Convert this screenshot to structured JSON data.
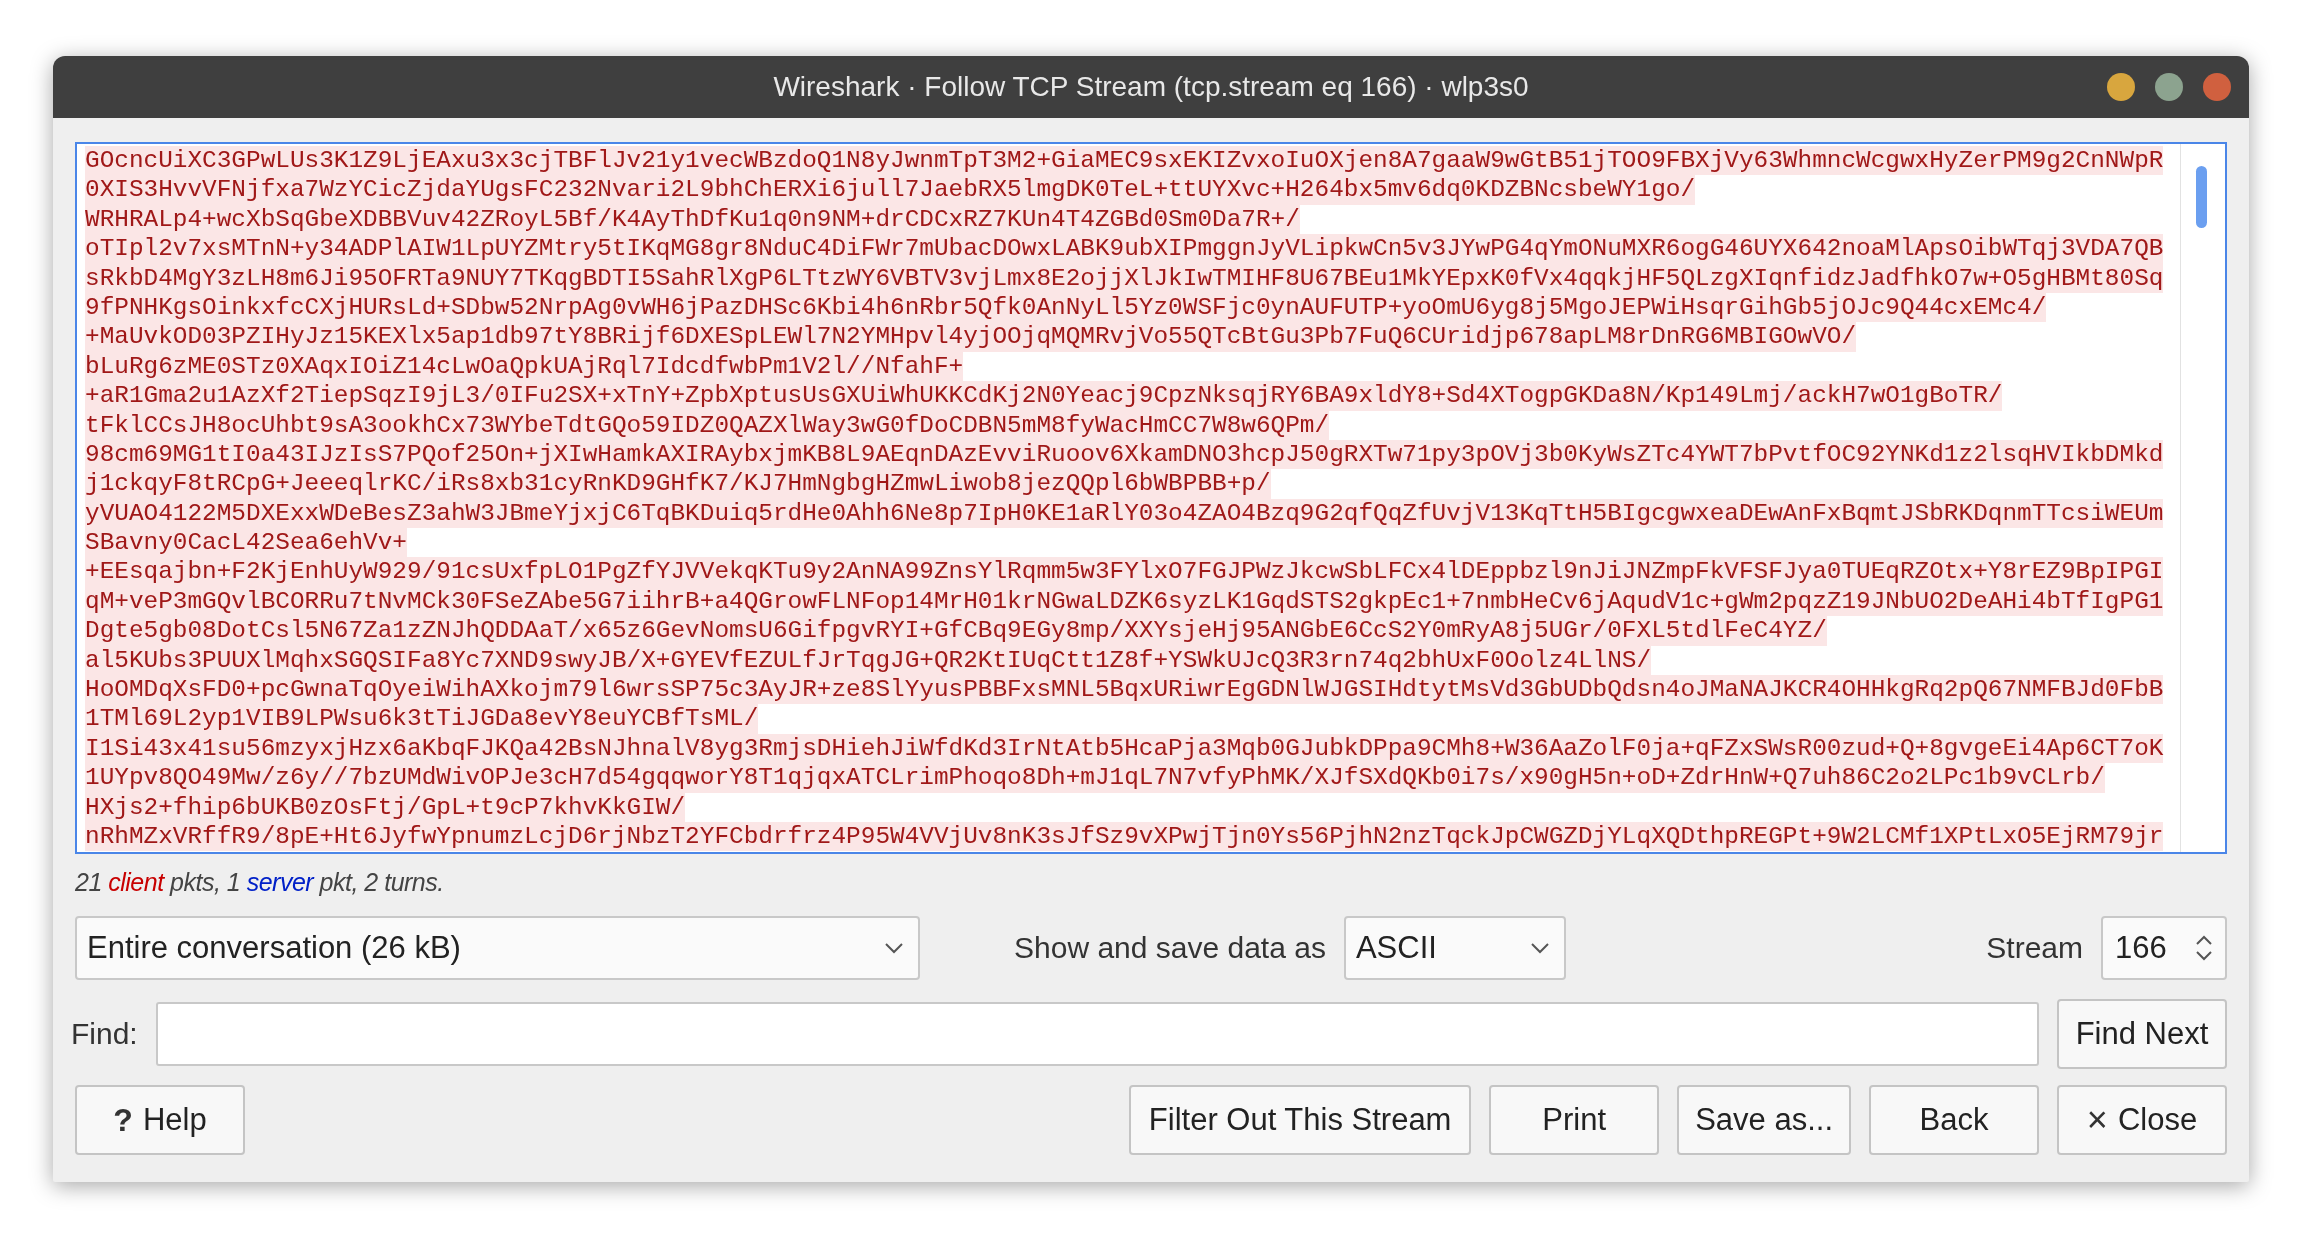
{
  "window": {
    "title": "Wireshark · Follow TCP Stream (tcp.stream eq 166) · wlp3s0"
  },
  "stream_lines": [
    {
      "kind": "client",
      "text": "GOcncUiXC3GPwLUs3K1Z9LjEAxu3x3cjTBFlJv21y1vecWBzdoQ1N8yJwnmTpT3M2+GiaMEC9sxEKIZvxoIuOXjen8A7gaaW9wGtB51jTOO9FBXjVy63WhmncWcgwxHyZerPM9g2CnNWpR"
    },
    {
      "kind": "client",
      "text": "0XIS3HvvVFNjfxa7WzYCicZjdaYUgsFC232Nvari2L9bhChERXi6jull7JaebRX5lmgDK0TeL+ttUYXvc+H264bx5mv6dq0KDZBNcsbeWY1go/"
    },
    {
      "kind": "client",
      "text": "WRHRALp4+wcXbSqGbeXDBBVuv42ZRoyL5Bf/K4AyThDfKu1q0n9NM+drCDCxRZ7KUn4T4ZGBd0Sm0Da7R+/"
    },
    {
      "kind": "client",
      "text": "oTIpl2v7xsMTnN+y34ADPlAIW1LpUYZMtry5tIKqMG8gr8NduC4DiFWr7mUbacDOwxLABK9ubXIPmggnJyVLipkwCn5v3JYwPG4qYmONuMXR6ogG46UYX642noaMlApsOibWTqj3VDA7QB"
    },
    {
      "kind": "client",
      "text": "sRkbD4MgY3zLH8m6Ji95OFRTa9NUY7TKqgBDTI5SahRlXgP6LTtzWY6VBTV3vjLmx8E2ojjXlJkIwTMIHF8U67BEu1MkYEpxK0fVx4qqkjHF5QLzgXIqnfidzJadfhkO7w+O5gHBMt80Sq"
    },
    {
      "kind": "client",
      "text": "9fPNHKgsOinkxfcCXjHURsLd+SDbw52NrpAg0vWH6jPazDHSc6Kbi4h6nRbr5Qfk0AnNyLl5Yz0WSFjc0ynAUFUTP+yoOmU6yg8j5MgoJEPWiHsqrGihGb5jOJc9Q44cxEMc4/"
    },
    {
      "kind": "client",
      "text": "+MaUvkOD03PZIHyJz15KEXlx5ap1db97tY8BRijf6DXESpLEWl7N2YMHpvl4yjOOjqMQMRvjVo55QTcBtGu3Pb7FuQ6CUridjp678apLM8rDnRG6MBIGOwVO/"
    },
    {
      "kind": "client",
      "text": "bLuRg6zME0STz0XAqxIOiZ14cLwOaQpkUAjRql7IdcdfwbPm1V2l//NfahF+"
    },
    {
      "kind": "client",
      "text": "+aR1Gma2u1AzXf2TiepSqzI9jL3/0IFu2SX+xTnY+ZpbXptusUsGXUiWhUKKCdKj2N0Yeacj9CpzNksqjRY6BA9xldY8+Sd4XTogpGKDa8N/Kp149Lmj/ackH7wO1gBoTR/"
    },
    {
      "kind": "client",
      "text": "tFklCCsJH8ocUhbt9sA3ookhCx73WYbeTdtGQo59IDZ0QAZXlWay3wG0fDoCDBN5mM8fyWacHmCC7W8w6QPm/"
    },
    {
      "kind": "client",
      "text": "98cm69MG1tI0a43IJzIsS7PQof25On+jXIwHamkAXIRAybxjmKB8L9AEqnDAzEvviRuoov6XkamDNO3hcpJ50gRXTw71py3pOVj3b0KyWsZTc4YWT7bPvtfOC92YNKd1z2lsqHVIkbDMkd"
    },
    {
      "kind": "client",
      "text": "j1ckqyF8tRCpG+JeeeqlrKC/iRs8xb31cyRnKD9GHfK7/KJ7HmNgbgHZmwLiwob8jezQQpl6bWBPBB+p/"
    },
    {
      "kind": "client",
      "text": "yVUAO4122M5DXExxWDeBesZ3ahW3JBmeYjxjC6TqBKDuiq5rdHe0Ahh6Ne8p7IpH0KE1aRlY03o4ZAO4Bzq9G2qfQqZfUvjV13KqTtH5BIgcgwxeaDEwAnFxBqmtJSbRKDqnmTTcsiWEUm"
    },
    {
      "kind": "client",
      "text": "SBavny0CacL42Sea6ehVv+"
    },
    {
      "kind": "client",
      "text": "+EEsqajbn+F2KjEnhUyW929/91csUxfpLO1PgZfYJVVekqKTu9y2AnNA99ZnsYlRqmm5w3FYlxO7FGJPWzJkcwSbLFCx4lDEppbzl9nJiJNZmpFkVFSFJya0TUEqRZOtx+Y8rEZ9BpIPGI"
    },
    {
      "kind": "client",
      "text": "qM+veP3mGQvlBCORRu7tNvMCk30FSeZAbe5G7iihrB+a4QGrowFLNFop14MrH01krNGwaLDZK6syzLK1GqdSTS2gkpEc1+7nmbHeCv6jAqudV1c+gWm2pqzZ19JNbUO2DeAHi4bTfIgPG1"
    },
    {
      "kind": "client",
      "text": "Dgte5gb08DotCsl5N67Za1zZNJhQDDAaT/x65z6GevNomsU6GifpgvRYI+GfCBq9EGy8mp/XXYsjeHj95ANGbE6CcS2Y0mRyA8j5UGr/0FXL5tdlFeC4YZ/"
    },
    {
      "kind": "client",
      "text": "al5KUbs3PUUXlMqhxSGQSIFa8Yc7XND9swyJB/X+GYEVfEZULfJrTqgJG+QR2KtIUqCtt1Z8f+YSWkUJcQ3R3rn74q2bhUxF0Oolz4LlNS/"
    },
    {
      "kind": "client",
      "text": "HoOMDqXsFD0+pcGwnaTqOyeiWihAXkojm79l6wrsSP75c3AyJR+ze8SlYyusPBBFxsMNL5BqxURiwrEgGDNlWJGSIHdtytMsVd3GbUDbQdsn4oJMaNAJKCR4OHHkgRq2pQ67NMFBJd0FbB"
    },
    {
      "kind": "client",
      "text": "1TMl69L2yp1VIB9LPWsu6k3tTiJGDa8evY8euYCBfTsML/"
    },
    {
      "kind": "client",
      "text": "I1Si43x41su56mzyxjHzx6aKbqFJKQa42BsNJhnalV8yg3RmjsDHiehJiWfdKd3IrNtAtb5HcaPja3Mqb0GJubkDPpa9CMh8+W36AaZolF0ja+qFZxSWsR00zud+Q+8gvgeEi4Ap6CT7oK"
    },
    {
      "kind": "client",
      "text": "1UYpv8QO49Mw/z6y//7bzUMdWivOPJe3cH7d54gqqworY8T1qjqxATCLrimPhoqo8Dh+mJ1qL7N7vfyPhMK/XJfSXdQKb0i7s/x90gH5n+oD+ZdrHnW+Q7uh86C2o2LPc1b9vCLrb/"
    },
    {
      "kind": "client",
      "text": "HXjs2+fhip6bUKB0zOsFtj/GpL+t9cP7khvKkGIW/"
    },
    {
      "kind": "client",
      "text": "nRhMZxVRffR9/8pE+Ht6JyfwYpnumzLcjD6rjNbzT2YFCbdrfrz4P95W4VVjUv8nK3sJfSz9vXPwjTjn0Ys56PjhN2nzTqckJpCWGZDjYLqXQDthpREGPt+9W2LCMf1XPtLxO5EjRM79jr"
    }
  ],
  "summary": [
    {
      "kind": "plain",
      "text": "21 "
    },
    {
      "kind": "client",
      "text": "client"
    },
    {
      "kind": "plain",
      "text": " pkts, 1 "
    },
    {
      "kind": "server",
      "text": "server"
    },
    {
      "kind": "plain",
      "text": " pkt, 2 turns."
    }
  ],
  "conversation_select": {
    "value": "Entire conversation (26 kB)"
  },
  "format_label": "Show and save data as",
  "format_select": {
    "value": "ASCII"
  },
  "stream_label": "Stream",
  "stream_spinbox": {
    "value": "166"
  },
  "find": {
    "label": "Find:"
  },
  "find_next_button": "Find Next",
  "help_button": {
    "icon": "?",
    "label": "Help"
  },
  "buttons": [
    {
      "label": "Filter Out This Stream"
    },
    {
      "label": "Print"
    },
    {
      "label": "Save as..."
    },
    {
      "label": "Back"
    },
    {
      "label": "Close",
      "icon": "×"
    }
  ]
}
